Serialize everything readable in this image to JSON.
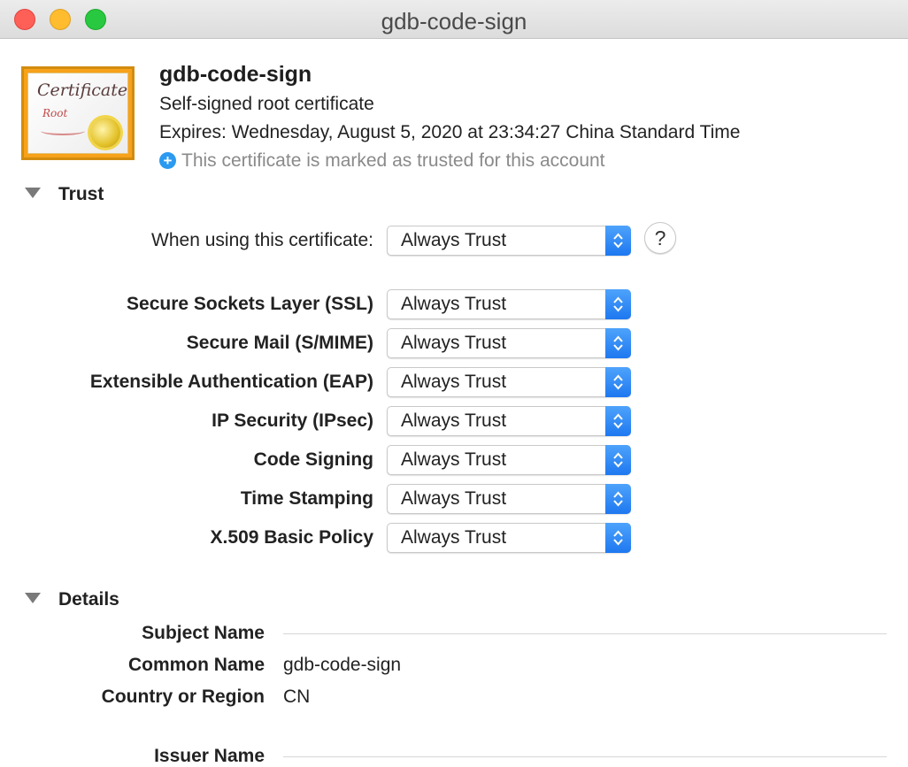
{
  "window": {
    "title": "gdb-code-sign"
  },
  "certificate": {
    "icon_word": "Certificate",
    "icon_sub": "Root",
    "name": "gdb-code-sign",
    "type": "Self-signed root certificate",
    "expires": "Expires: Wednesday, August 5, 2020 at 23:34:27 China Standard Time",
    "trusted_note": "This certificate is marked as trusted for this account"
  },
  "trust": {
    "heading": "Trust",
    "when_using_label": "When using this certificate:",
    "when_using_value": "Always Trust",
    "help_label": "?",
    "policies": [
      {
        "label": "Secure Sockets Layer (SSL)",
        "value": "Always Trust"
      },
      {
        "label": "Secure Mail (S/MIME)",
        "value": "Always Trust"
      },
      {
        "label": "Extensible Authentication (EAP)",
        "value": "Always Trust"
      },
      {
        "label": "IP Security (IPsec)",
        "value": "Always Trust"
      },
      {
        "label": "Code Signing",
        "value": "Always Trust"
      },
      {
        "label": "Time Stamping",
        "value": "Always Trust"
      },
      {
        "label": "X.509 Basic Policy",
        "value": "Always Trust"
      }
    ]
  },
  "details": {
    "heading": "Details",
    "subject_name_label": "Subject Name",
    "common_name_label": "Common Name",
    "common_name_value": "gdb-code-sign",
    "country_label": "Country or Region",
    "country_value": "CN",
    "issuer_name_label": "Issuer Name"
  },
  "colors": {
    "accent": "#1e78f0",
    "info_icon": "#2b9af0"
  }
}
